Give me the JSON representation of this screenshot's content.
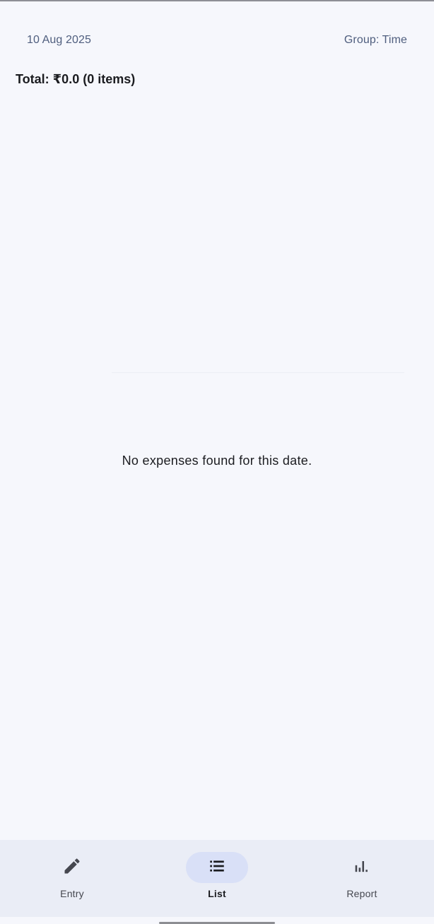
{
  "header": {
    "date_label": "10 Aug 2025",
    "group_label": "Group: Time"
  },
  "summary": {
    "total_text": "Total: ₹0.0 (0 items)"
  },
  "list": {
    "empty_message": "No expenses found for this date."
  },
  "bottom_nav": {
    "selected": "List",
    "items": [
      {
        "label": "Entry",
        "icon": "pencil-icon"
      },
      {
        "label": "List",
        "icon": "list-icon"
      },
      {
        "label": "Report",
        "icon": "bar-chart-icon"
      }
    ]
  },
  "colors": {
    "background": "#f6f7fc",
    "nav_background": "#eaedf6",
    "selected_pill": "#d9e0f7",
    "header_text": "#4f5e7e"
  }
}
